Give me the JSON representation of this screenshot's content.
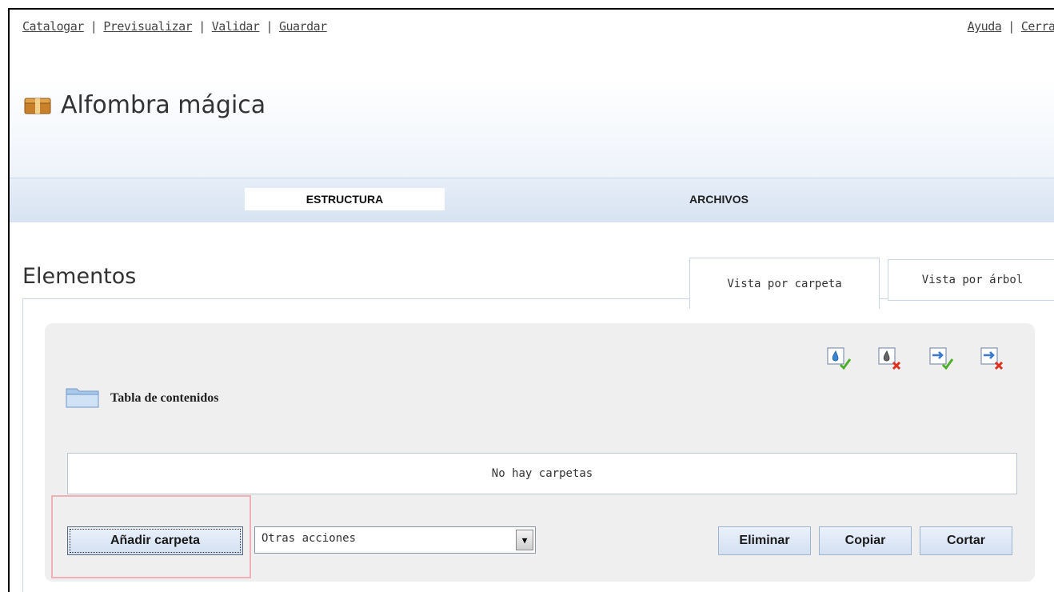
{
  "top_nav": {
    "left": [
      {
        "label": "Catalogar"
      },
      {
        "label": "Previsualizar"
      },
      {
        "label": "Validar"
      },
      {
        "label": "Guardar"
      }
    ],
    "right": [
      {
        "label": "Ayuda"
      },
      {
        "label": "Cerrar"
      }
    ],
    "separator": "|"
  },
  "page": {
    "title": "Alfombra mágica",
    "icon": "package-box-icon"
  },
  "main_tabs": [
    {
      "label": "ESTRUCTURA",
      "active": true
    },
    {
      "label": "ARCHIVOS",
      "active": false
    }
  ],
  "section": {
    "title": "Elementos",
    "view_tabs": [
      {
        "label": "Vista por carpeta",
        "active": true
      },
      {
        "label": "Vista por árbol",
        "active": false
      }
    ]
  },
  "panel": {
    "folder_label": "Tabla de contenidos",
    "folder_icon": "folder-icon",
    "action_icons": [
      {
        "name": "drop-accept-icon"
      },
      {
        "name": "drop-remove-icon"
      },
      {
        "name": "arrow-accept-icon"
      },
      {
        "name": "arrow-remove-icon"
      }
    ],
    "empty_message": "No hay carpetas",
    "add_folder_label": "Añadir carpeta",
    "other_actions": {
      "selected": "Otras acciones"
    },
    "delete_label": "Eliminar",
    "copy_label": "Copiar",
    "cut_label": "Cortar"
  },
  "colors": {
    "tab_bar": "#dbe6f3",
    "panel_bg": "#efefef",
    "highlight_border": "#f0b0b8",
    "button_bg": "#d3e0f1"
  }
}
